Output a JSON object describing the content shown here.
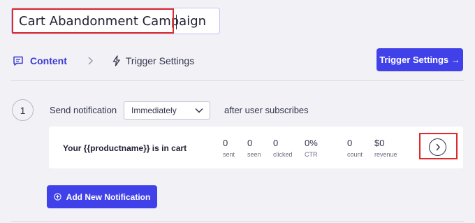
{
  "campaign": {
    "name": "Cart Abandonment Campaign"
  },
  "tabs": [
    {
      "label": "Content",
      "icon": "message-icon",
      "active": true
    },
    {
      "label": "Trigger Settings",
      "icon": "lightning-icon",
      "active": false
    }
  ],
  "header": {
    "trigger_button_label": "Trigger Settings →"
  },
  "step": {
    "number": "1",
    "send_label": "Send notification",
    "timing_value": "Immediately",
    "after_label": "after user subscribes"
  },
  "notification": {
    "title": "Your {{productname}} is in cart",
    "stats": [
      {
        "value": "0",
        "label": "sent"
      },
      {
        "value": "0",
        "label": "seen"
      },
      {
        "value": "0",
        "label": "clicked"
      },
      {
        "value": "0%",
        "label": "CTR"
      },
      {
        "value": "0",
        "label": "count"
      },
      {
        "value": "$0",
        "label": "revenue"
      }
    ]
  },
  "actions": {
    "add_notification_label": "Add New Notification"
  },
  "colors": {
    "accent": "#4141ea",
    "highlight": "#e02a2a",
    "tab_active": "#3b3bd1",
    "background": "#f1f1f6"
  }
}
